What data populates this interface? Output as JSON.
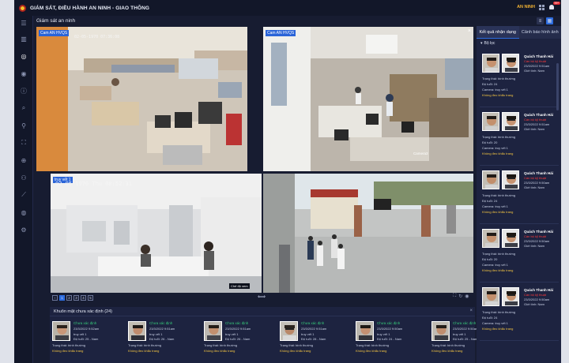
{
  "header": {
    "title": "GIÁM SÁT, ĐIỀU HÀNH AN NINH - GIAO THÔNG",
    "user": "AN NINH",
    "notification_count": "99+"
  },
  "page": {
    "title": "Giám sát an ninh"
  },
  "cameras": [
    {
      "label": "Cam AN HVQS",
      "timestamp": "02-05-1970  07:36:08"
    },
    {
      "label": "Cam AN HVQS",
      "timestamp": ""
    },
    {
      "label": "truy vết 1",
      "timestamp": "02-05-1970 Thu 08:52:31"
    },
    {
      "label": "",
      "timestamp": ""
    }
  ],
  "camera_overlays": {
    "cam2_text": "Camera3",
    "cam3_caption": "Chế độ xem"
  },
  "pager": [
    "1",
    "2",
    "3",
    "4",
    "5",
    "6"
  ],
  "strip": {
    "title": "Khuôn mặt chưa xác định (24)",
    "cards": [
      {
        "status": "Chưa xác định",
        "time": "23/3/2022 9:52am",
        "track": "truy vết 1",
        "age": "Độ tuổi: 25 - Nam",
        "state": "Trạng thái: bình thường",
        "mask": "Không đeo khẩu trang"
      },
      {
        "status": "Chưa xác định",
        "time": "23/3/2022 9:51am",
        "track": "truy vết 1",
        "age": "Độ tuổi: 26 - Nam",
        "state": "Trạng thái: bình thường",
        "mask": "Không đeo khẩu trang"
      },
      {
        "status": "Chưa xác định",
        "time": "23/3/2022 9:51am",
        "track": "truy vết 1",
        "age": "Độ tuổi: 26 - Nam",
        "state": "Trạng thái: bình thường",
        "mask": "Không đeo khẩu trang"
      },
      {
        "status": "Chưa xác định",
        "time": "23/3/2022 9:51am",
        "track": "truy vết 1",
        "age": "Độ tuổi: 28 - Nam",
        "state": "Trạng thái: bình thường",
        "mask": "Không đeo khẩu trang"
      },
      {
        "status": "Chưa xác định",
        "time": "23/3/2022 9:50am",
        "track": "truy vết 1",
        "age": "Độ tuổi: 24 - Nam",
        "state": "Trạng thái: bình thường",
        "mask": "Không đeo khẩu trang"
      },
      {
        "status": "Chưa xác định",
        "time": "23/3/2022 9:50am",
        "track": "truy vết 1",
        "age": "Độ tuổi: 25 - Nam",
        "state": "Trạng thái: bình thường",
        "mask": "Không đeo khẩu trang"
      }
    ]
  },
  "right_panel": {
    "tabs": [
      "Kết quả nhận dạng",
      "Cảnh báo hình ảnh"
    ],
    "filter": "Bộ lọc",
    "cards": [
      {
        "name": "Quách Thanh Hải",
        "role": "Cán bộ kỹ thuật",
        "time": "23/3/2022 9:51am",
        "gender": "Giới tính: Nam",
        "state": "Trạng thái: bình thường",
        "age": "Độ tuổi: 24",
        "camera": "Camera: truy vết 1",
        "mask": "Không đeo khẩu trang"
      },
      {
        "name": "Quách Thanh Hải",
        "role": "Cán bộ kỹ thuật",
        "time": "23/3/2022 9:51am",
        "gender": "Giới tính: Nam",
        "state": "Trạng thái: bình thường",
        "age": "Độ tuổi: 20",
        "camera": "Camera: truy vết 1",
        "mask": "Không đeo khẩu trang"
      },
      {
        "name": "Quách Thanh Hải",
        "role": "Cán bộ kỹ thuật",
        "time": "23/3/2022 9:50am",
        "gender": "Giới tính: Nam",
        "state": "Trạng thái: bình thường",
        "age": "Độ tuổi: 24",
        "camera": "Camera: truy vết 1",
        "mask": "Không đeo khẩu trang"
      },
      {
        "name": "Quách Thanh Hải",
        "role": "Cán bộ kỹ thuật",
        "time": "23/3/2022 9:50am",
        "gender": "Giới tính: Nam",
        "state": "Trạng thái: bình thường",
        "age": "Độ tuổi: 20",
        "camera": "Camera: truy vết 1",
        "mask": "Không đeo khẩu trang"
      },
      {
        "name": "Quách Thanh Hải",
        "role": "Cán bộ kỹ thuật",
        "time": "23/3/2022 9:50am",
        "gender": "Giới tính: Nam",
        "state": "Trạng thái: bình thường",
        "age": "Độ tuổi: 24",
        "camera": "Camera: truy vết 1",
        "mask": "Không đeo khẩu trang"
      }
    ]
  },
  "colors": {
    "accent": "#2d6cdf",
    "danger": "#ff3b3b",
    "ok": "#36c97a",
    "warn": "#f4c542"
  }
}
